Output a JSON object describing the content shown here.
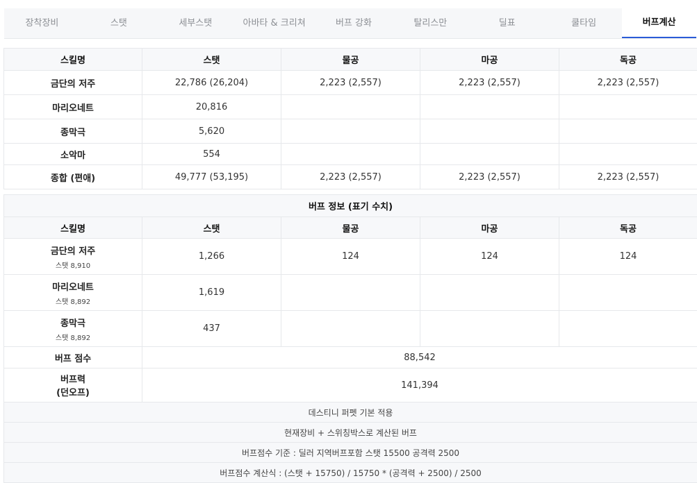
{
  "tabs": [
    {
      "label": "장착장비",
      "active": false
    },
    {
      "label": "스탯",
      "active": false
    },
    {
      "label": "세부스탯",
      "active": false
    },
    {
      "label": "아바타 & 크리쳐",
      "active": false
    },
    {
      "label": "버프 강화",
      "active": false
    },
    {
      "label": "탈리스만",
      "active": false
    },
    {
      "label": "딜표",
      "active": false
    },
    {
      "label": "쿨타임",
      "active": false
    },
    {
      "label": "버프계산",
      "active": true
    }
  ],
  "table1": {
    "headers": [
      "스킬명",
      "스탯",
      "물공",
      "마공",
      "독공"
    ],
    "rows": [
      [
        "금단의 저주",
        "22,786 (26,204)",
        "2,223 (2,557)",
        "2,223 (2,557)",
        "2,223 (2,557)"
      ],
      [
        "마리오네트",
        "20,816",
        "",
        "",
        ""
      ],
      [
        "종막극",
        "5,620",
        "",
        "",
        ""
      ],
      [
        "소악마",
        "554",
        "",
        "",
        ""
      ],
      [
        "종합 (편애)",
        "49,777 (53,195)",
        "2,223 (2,557)",
        "2,223 (2,557)",
        "2,223 (2,557)"
      ]
    ]
  },
  "table2": {
    "title": "버프 정보 (표기 수치)",
    "headers": [
      "스킬명",
      "스탯",
      "물공",
      "마공",
      "독공"
    ],
    "rows": [
      {
        "name": "금단의 저주",
        "sub": "스탯 8,910",
        "values": [
          "1,266",
          "124",
          "124",
          "124"
        ]
      },
      {
        "name": "마리오네트",
        "sub": "스탯 8,892",
        "values": [
          "1,619",
          "",
          "",
          ""
        ]
      },
      {
        "name": "종막극",
        "sub": "스탯 8,892",
        "values": [
          "437",
          "",
          "",
          ""
        ]
      }
    ],
    "buff_score_label": "버프 점수",
    "buff_score_value": "88,542",
    "buff_power_label_line1": "버프력",
    "buff_power_label_line2": "(던오프)",
    "buff_power_value": "141,394",
    "notes": [
      "데스티니 퍼펫 기본 적용",
      "현재장비 + 스위칭박스로 계산된 버프",
      "버프점수 기준 : 딜러 지역버프포함 스탯 15500 공격력 2500",
      "버프점수 계산식 : (스탯 + 15750) / 15750 * (공격력 + 2500) / 2500"
    ]
  },
  "colors": {
    "accent": "#2a5bd7",
    "header_bg": "#f7f8fa",
    "border": "#e6e8eb"
  }
}
